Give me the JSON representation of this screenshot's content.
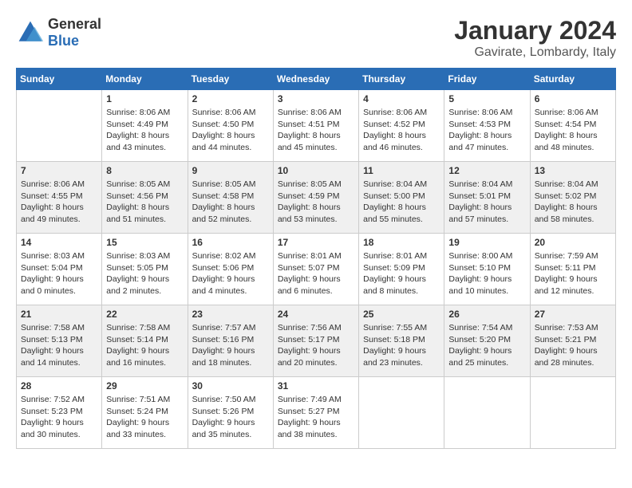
{
  "logo": {
    "general": "General",
    "blue": "Blue"
  },
  "title": "January 2024",
  "location": "Gavirate, Lombardy, Italy",
  "headers": [
    "Sunday",
    "Monday",
    "Tuesday",
    "Wednesday",
    "Thursday",
    "Friday",
    "Saturday"
  ],
  "weeks": [
    [
      {
        "day": "",
        "sunrise": "",
        "sunset": "",
        "daylight": ""
      },
      {
        "day": "1",
        "sunrise": "Sunrise: 8:06 AM",
        "sunset": "Sunset: 4:49 PM",
        "daylight": "Daylight: 8 hours and 43 minutes."
      },
      {
        "day": "2",
        "sunrise": "Sunrise: 8:06 AM",
        "sunset": "Sunset: 4:50 PM",
        "daylight": "Daylight: 8 hours and 44 minutes."
      },
      {
        "day": "3",
        "sunrise": "Sunrise: 8:06 AM",
        "sunset": "Sunset: 4:51 PM",
        "daylight": "Daylight: 8 hours and 45 minutes."
      },
      {
        "day": "4",
        "sunrise": "Sunrise: 8:06 AM",
        "sunset": "Sunset: 4:52 PM",
        "daylight": "Daylight: 8 hours and 46 minutes."
      },
      {
        "day": "5",
        "sunrise": "Sunrise: 8:06 AM",
        "sunset": "Sunset: 4:53 PM",
        "daylight": "Daylight: 8 hours and 47 minutes."
      },
      {
        "day": "6",
        "sunrise": "Sunrise: 8:06 AM",
        "sunset": "Sunset: 4:54 PM",
        "daylight": "Daylight: 8 hours and 48 minutes."
      }
    ],
    [
      {
        "day": "7",
        "sunrise": "Sunrise: 8:06 AM",
        "sunset": "Sunset: 4:55 PM",
        "daylight": "Daylight: 8 hours and 49 minutes."
      },
      {
        "day": "8",
        "sunrise": "Sunrise: 8:05 AM",
        "sunset": "Sunset: 4:56 PM",
        "daylight": "Daylight: 8 hours and 51 minutes."
      },
      {
        "day": "9",
        "sunrise": "Sunrise: 8:05 AM",
        "sunset": "Sunset: 4:58 PM",
        "daylight": "Daylight: 8 hours and 52 minutes."
      },
      {
        "day": "10",
        "sunrise": "Sunrise: 8:05 AM",
        "sunset": "Sunset: 4:59 PM",
        "daylight": "Daylight: 8 hours and 53 minutes."
      },
      {
        "day": "11",
        "sunrise": "Sunrise: 8:04 AM",
        "sunset": "Sunset: 5:00 PM",
        "daylight": "Daylight: 8 hours and 55 minutes."
      },
      {
        "day": "12",
        "sunrise": "Sunrise: 8:04 AM",
        "sunset": "Sunset: 5:01 PM",
        "daylight": "Daylight: 8 hours and 57 minutes."
      },
      {
        "day": "13",
        "sunrise": "Sunrise: 8:04 AM",
        "sunset": "Sunset: 5:02 PM",
        "daylight": "Daylight: 8 hours and 58 minutes."
      }
    ],
    [
      {
        "day": "14",
        "sunrise": "Sunrise: 8:03 AM",
        "sunset": "Sunset: 5:04 PM",
        "daylight": "Daylight: 9 hours and 0 minutes."
      },
      {
        "day": "15",
        "sunrise": "Sunrise: 8:03 AM",
        "sunset": "Sunset: 5:05 PM",
        "daylight": "Daylight: 9 hours and 2 minutes."
      },
      {
        "day": "16",
        "sunrise": "Sunrise: 8:02 AM",
        "sunset": "Sunset: 5:06 PM",
        "daylight": "Daylight: 9 hours and 4 minutes."
      },
      {
        "day": "17",
        "sunrise": "Sunrise: 8:01 AM",
        "sunset": "Sunset: 5:07 PM",
        "daylight": "Daylight: 9 hours and 6 minutes."
      },
      {
        "day": "18",
        "sunrise": "Sunrise: 8:01 AM",
        "sunset": "Sunset: 5:09 PM",
        "daylight": "Daylight: 9 hours and 8 minutes."
      },
      {
        "day": "19",
        "sunrise": "Sunrise: 8:00 AM",
        "sunset": "Sunset: 5:10 PM",
        "daylight": "Daylight: 9 hours and 10 minutes."
      },
      {
        "day": "20",
        "sunrise": "Sunrise: 7:59 AM",
        "sunset": "Sunset: 5:11 PM",
        "daylight": "Daylight: 9 hours and 12 minutes."
      }
    ],
    [
      {
        "day": "21",
        "sunrise": "Sunrise: 7:58 AM",
        "sunset": "Sunset: 5:13 PM",
        "daylight": "Daylight: 9 hours and 14 minutes."
      },
      {
        "day": "22",
        "sunrise": "Sunrise: 7:58 AM",
        "sunset": "Sunset: 5:14 PM",
        "daylight": "Daylight: 9 hours and 16 minutes."
      },
      {
        "day": "23",
        "sunrise": "Sunrise: 7:57 AM",
        "sunset": "Sunset: 5:16 PM",
        "daylight": "Daylight: 9 hours and 18 minutes."
      },
      {
        "day": "24",
        "sunrise": "Sunrise: 7:56 AM",
        "sunset": "Sunset: 5:17 PM",
        "daylight": "Daylight: 9 hours and 20 minutes."
      },
      {
        "day": "25",
        "sunrise": "Sunrise: 7:55 AM",
        "sunset": "Sunset: 5:18 PM",
        "daylight": "Daylight: 9 hours and 23 minutes."
      },
      {
        "day": "26",
        "sunrise": "Sunrise: 7:54 AM",
        "sunset": "Sunset: 5:20 PM",
        "daylight": "Daylight: 9 hours and 25 minutes."
      },
      {
        "day": "27",
        "sunrise": "Sunrise: 7:53 AM",
        "sunset": "Sunset: 5:21 PM",
        "daylight": "Daylight: 9 hours and 28 minutes."
      }
    ],
    [
      {
        "day": "28",
        "sunrise": "Sunrise: 7:52 AM",
        "sunset": "Sunset: 5:23 PM",
        "daylight": "Daylight: 9 hours and 30 minutes."
      },
      {
        "day": "29",
        "sunrise": "Sunrise: 7:51 AM",
        "sunset": "Sunset: 5:24 PM",
        "daylight": "Daylight: 9 hours and 33 minutes."
      },
      {
        "day": "30",
        "sunrise": "Sunrise: 7:50 AM",
        "sunset": "Sunset: 5:26 PM",
        "daylight": "Daylight: 9 hours and 35 minutes."
      },
      {
        "day": "31",
        "sunrise": "Sunrise: 7:49 AM",
        "sunset": "Sunset: 5:27 PM",
        "daylight": "Daylight: 9 hours and 38 minutes."
      },
      {
        "day": "",
        "sunrise": "",
        "sunset": "",
        "daylight": ""
      },
      {
        "day": "",
        "sunrise": "",
        "sunset": "",
        "daylight": ""
      },
      {
        "day": "",
        "sunrise": "",
        "sunset": "",
        "daylight": ""
      }
    ]
  ]
}
